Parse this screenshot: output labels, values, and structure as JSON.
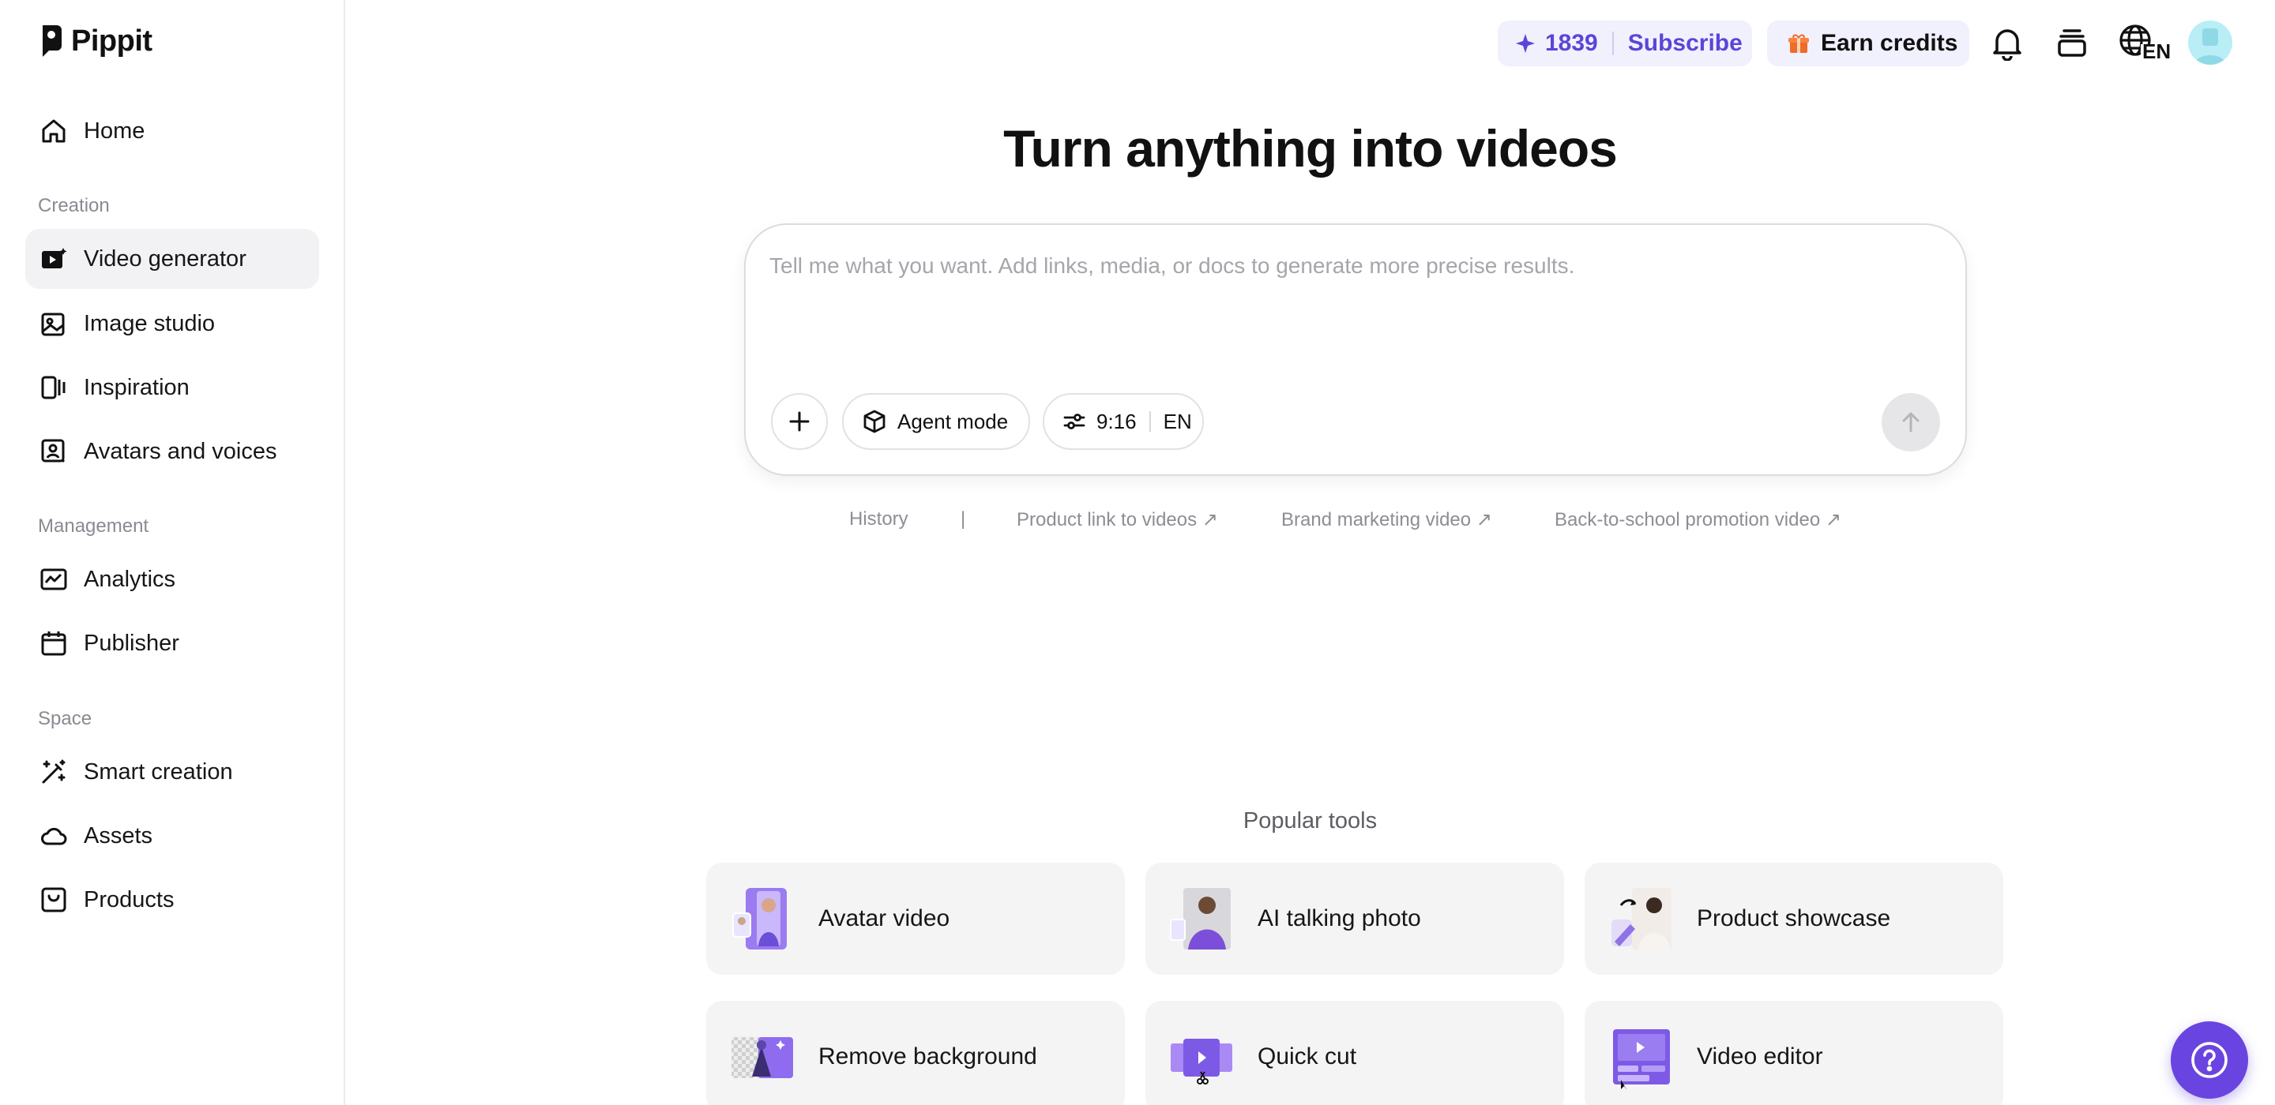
{
  "brand": {
    "name": "Pippit"
  },
  "sidebar": {
    "home": "Home",
    "sections": [
      {
        "label": "Creation",
        "items": [
          "Video generator",
          "Image studio",
          "Inspiration",
          "Avatars and voices"
        ]
      },
      {
        "label": "Management",
        "items": [
          "Analytics",
          "Publisher"
        ]
      },
      {
        "label": "Space",
        "items": [
          "Smart creation",
          "Assets",
          "Products"
        ]
      }
    ],
    "active_item": "Video generator"
  },
  "header": {
    "credits": "1839",
    "subscribe_label": "Subscribe",
    "earn_label": "Earn credits",
    "language": "EN",
    "accent_color": "#5b45d8"
  },
  "main": {
    "title": "Turn anything into videos",
    "prompt": {
      "placeholder": "Tell me what you want. Add links, media, or docs to generate more precise results.",
      "value": "",
      "agent_mode_label": "Agent mode",
      "ratio": "9:16",
      "language": "EN"
    },
    "suggestions": {
      "history": "History",
      "divider": "|",
      "items": [
        "Product link to videos ↗",
        "Brand marketing video ↗",
        "Back-to-school promotion video ↗"
      ]
    },
    "popular_tools": {
      "title": "Popular tools",
      "items": [
        "Avatar video",
        "AI talking photo",
        "Product showcase",
        "Remove background",
        "Quick cut",
        "Video editor"
      ]
    }
  }
}
